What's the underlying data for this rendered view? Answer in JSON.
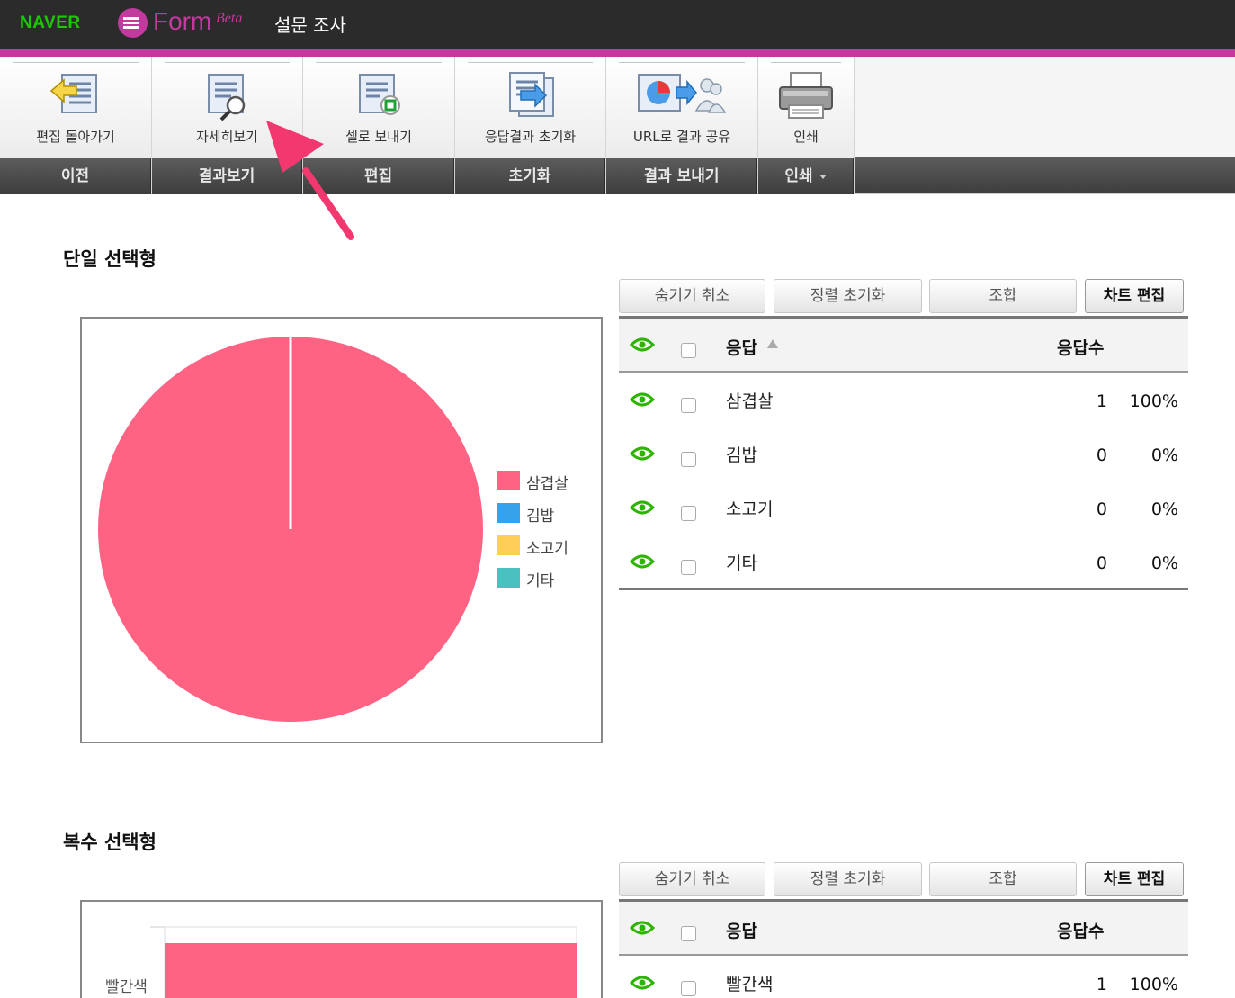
{
  "header": {
    "naver": "NAVER",
    "form": "Form",
    "beta": "Beta",
    "survey_title": "설문 조사"
  },
  "toolbar": {
    "groups": [
      {
        "tool_label": "편집 돌아가기",
        "group_label": "이전",
        "icon": "back-edit-icon"
      },
      {
        "tool_label": "자세히보기",
        "group_label": "결과보기",
        "icon": "detail-view-icon"
      },
      {
        "tool_label": "셀로 보내기",
        "group_label": "편집",
        "icon": "send-to-cell-icon"
      },
      {
        "tool_label": "응답결과 초기화",
        "group_label": "초기화",
        "icon": "reset-results-icon"
      },
      {
        "tool_label": "URL로 결과 공유",
        "group_label": "결과 보내기",
        "icon": "share-url-icon"
      },
      {
        "tool_label": "인쇄",
        "group_label": "인쇄",
        "icon": "printer-icon"
      }
    ]
  },
  "sections": [
    {
      "title": "단일 선택형",
      "buttons": [
        "숨기기 취소",
        "정렬 초기화",
        "조합",
        "차트 편집"
      ],
      "table_head": {
        "response": "응답",
        "count": "응답수"
      },
      "rows": [
        {
          "response": "삼겹살",
          "count": "1",
          "pct": "100%"
        },
        {
          "response": "김밥",
          "count": "0",
          "pct": "0%"
        },
        {
          "response": "소고기",
          "count": "0",
          "pct": "0%"
        },
        {
          "response": "기타",
          "count": "0",
          "pct": "0%"
        }
      ]
    },
    {
      "title": "복수 선택형",
      "buttons": [
        "숨기기 취소",
        "정렬 초기화",
        "조합",
        "차트 편집"
      ],
      "table_head": {
        "response": "응답",
        "count": "응답수"
      },
      "rows": [
        {
          "response": "빨간색",
          "count": "1",
          "pct": "100%"
        }
      ]
    }
  ],
  "chart_data": [
    {
      "type": "pie",
      "categories": [
        "삼겹살",
        "김밥",
        "소고기",
        "기타"
      ],
      "values": [
        1,
        0,
        0,
        0
      ],
      "colors": [
        "#ff6384",
        "#36a2eb",
        "#ffce56",
        "#4bc0c0"
      ],
      "legend": "right"
    },
    {
      "type": "bar",
      "orientation": "horizontal",
      "categories": [
        "빨간색"
      ],
      "values": [
        1
      ],
      "colors": [
        "#ff6384"
      ]
    }
  ],
  "colors": {
    "accent": "#c23a9d",
    "naver_green": "#1ec800",
    "eye_green": "#2db400",
    "arrow": "#f2386f"
  }
}
